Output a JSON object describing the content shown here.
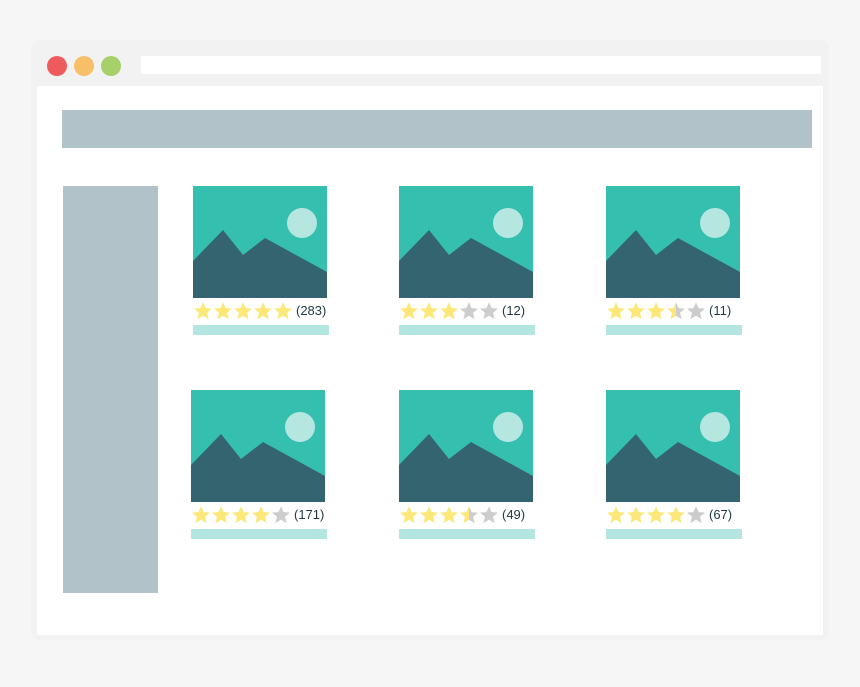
{
  "colors": {
    "close_dot": "#ef5a5e",
    "minimize_dot": "#f8bf69",
    "maximize_dot": "#a6d16a",
    "placeholder_bar": "#b1c3c9",
    "image_sky": "#35bfae",
    "image_mountain": "#33646f",
    "image_sun": "#b5e6e0",
    "star_filled": "#fbe878",
    "star_empty": "#cdcdcd",
    "caption_bar": "#b3e6e0"
  },
  "window": {
    "controls": [
      "close-dot",
      "minimize-dot",
      "maximize-dot"
    ],
    "address_bar": ""
  },
  "products": [
    {
      "image_icon": "landscape-image-icon",
      "rating": 5,
      "count_label": "(283)"
    },
    {
      "image_icon": "landscape-image-icon",
      "rating": 3,
      "count_label": "(12)"
    },
    {
      "image_icon": "landscape-image-icon",
      "rating": 3.5,
      "count_label": "(11)"
    },
    {
      "image_icon": "landscape-image-icon",
      "rating": 4,
      "count_label": "(171)"
    },
    {
      "image_icon": "landscape-image-icon",
      "rating": 3.5,
      "count_label": "(49)"
    },
    {
      "image_icon": "landscape-image-icon",
      "rating": 4,
      "count_label": "(67)"
    }
  ],
  "star_icon": "star-icon",
  "max_rating": 5
}
